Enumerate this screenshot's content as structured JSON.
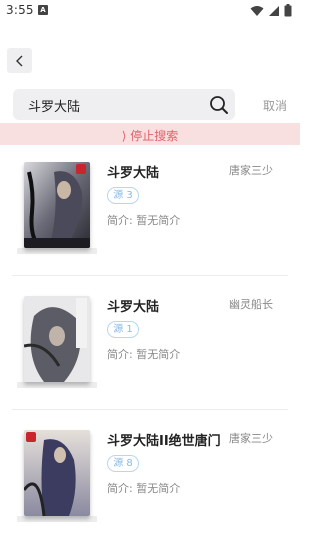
{
  "status_bar": {
    "time": "3:55"
  },
  "header": {
    "back_icon": "chevron-left-icon"
  },
  "search": {
    "query": "斗罗大陆",
    "cancel_label": "取消"
  },
  "stop_bar": {
    "label": "⟩ 停止搜索"
  },
  "results": [
    {
      "title": "斗罗大陆",
      "author": "唐家三少",
      "source": "源 3",
      "intro": "简介: 暂无简介"
    },
    {
      "title": "斗罗大陆",
      "author": "幽灵船长",
      "source": "源 1",
      "intro": "简介: 暂无简介"
    },
    {
      "title": "斗罗大陆II绝世唐门",
      "author": "唐家三少",
      "source": "源 8",
      "intro": "简介: 暂无简介"
    }
  ]
}
